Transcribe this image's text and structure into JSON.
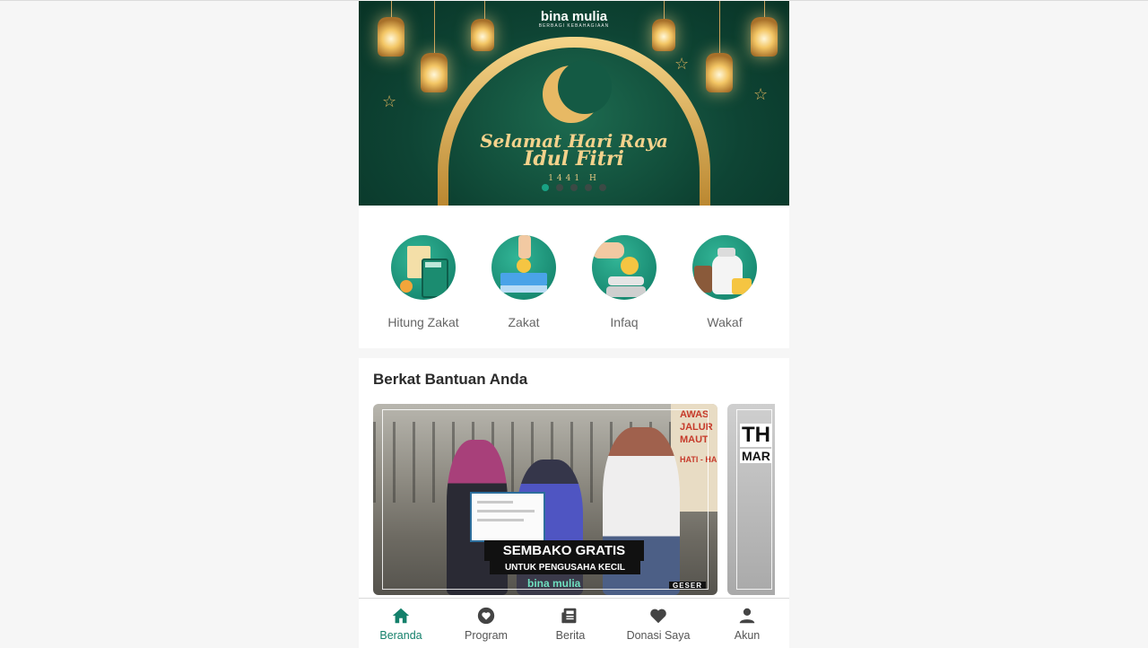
{
  "banner": {
    "brand": "bina mulia",
    "brand_tagline": "BERBAGI KEBAHAGIAAN",
    "greeting_line1": "Selamat Hari Raya",
    "greeting_line2": "Idul Fitri",
    "year": "1441 H",
    "slide_count": 5,
    "active_slide": 1
  },
  "categories": [
    {
      "label": "Hitung Zakat",
      "icon": "calculator-icon"
    },
    {
      "label": "Zakat",
      "icon": "zakat-coin-icon"
    },
    {
      "label": "Infaq",
      "icon": "infaq-hand-icon"
    },
    {
      "label": "Wakaf",
      "icon": "wakaf-bag-icon"
    }
  ],
  "section": {
    "title": "Berkat Bantuan Anda",
    "cards": [
      {
        "headline": "SEMBAKO GRATIS",
        "subline": "UNTUK PENGUSAHA KECIL",
        "brand": "bina mulia",
        "tag": "GESER",
        "sign_text": [
          "AWAS",
          "JALUR",
          "MAUT",
          "HATI - HA"
        ]
      },
      {
        "headline": "TH",
        "subline": "MAR"
      }
    ]
  },
  "nav": [
    {
      "label": "Beranda",
      "icon": "home-icon",
      "active": true
    },
    {
      "label": "Program",
      "icon": "heart-circle-icon",
      "active": false
    },
    {
      "label": "Berita",
      "icon": "newspaper-icon",
      "active": false
    },
    {
      "label": "Donasi Saya",
      "icon": "heart-icon",
      "active": false
    },
    {
      "label": "Akun",
      "icon": "user-icon",
      "active": false
    }
  ],
  "colors": {
    "accent": "#14806b",
    "banner_bg": "#0e4434",
    "gold": "#e7b964",
    "inactive_icon": "#444444"
  }
}
